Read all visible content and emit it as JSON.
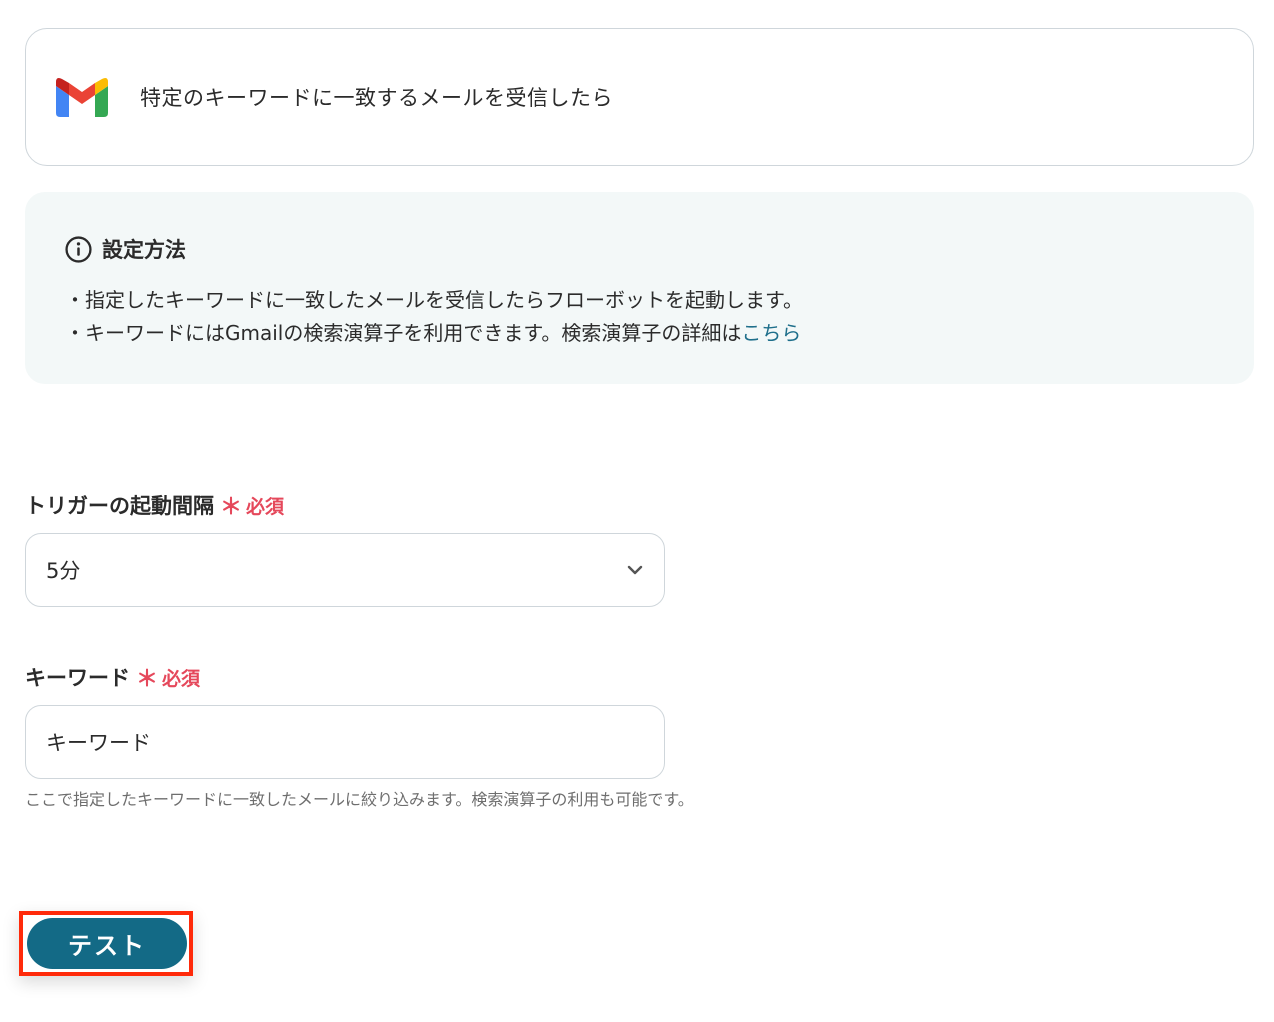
{
  "trigger": {
    "title": "特定のキーワードに一致するメールを受信したら",
    "logo_icon": "gmail-logo-icon"
  },
  "info": {
    "icon": "info-circle-icon",
    "title": "設定方法",
    "line1": "・指定したキーワードに一致したメールを受信したらフローボットを起動します。",
    "line2_prefix": "・キーワードにはGmailの検索演算子を利用できます。検索演算子の詳細は",
    "line2_link": "こちら"
  },
  "interval": {
    "label": "トリガーの起動間隔",
    "required_mark": "＊",
    "required_text": "必須",
    "selected_value": "5分"
  },
  "keyword": {
    "label": "キーワード",
    "required_mark": "＊",
    "required_text": "必須",
    "value": "キーワード",
    "hint": "ここで指定したキーワードに一致したメールに絞り込みます。検索演算子の利用も可能です。"
  },
  "test_button": {
    "label": "テスト"
  },
  "colors": {
    "primary": "#136a86",
    "required": "#e5485b",
    "link": "#1f6f8b",
    "info_bg": "#f3f8f8",
    "highlight": "#ff2a0a"
  }
}
